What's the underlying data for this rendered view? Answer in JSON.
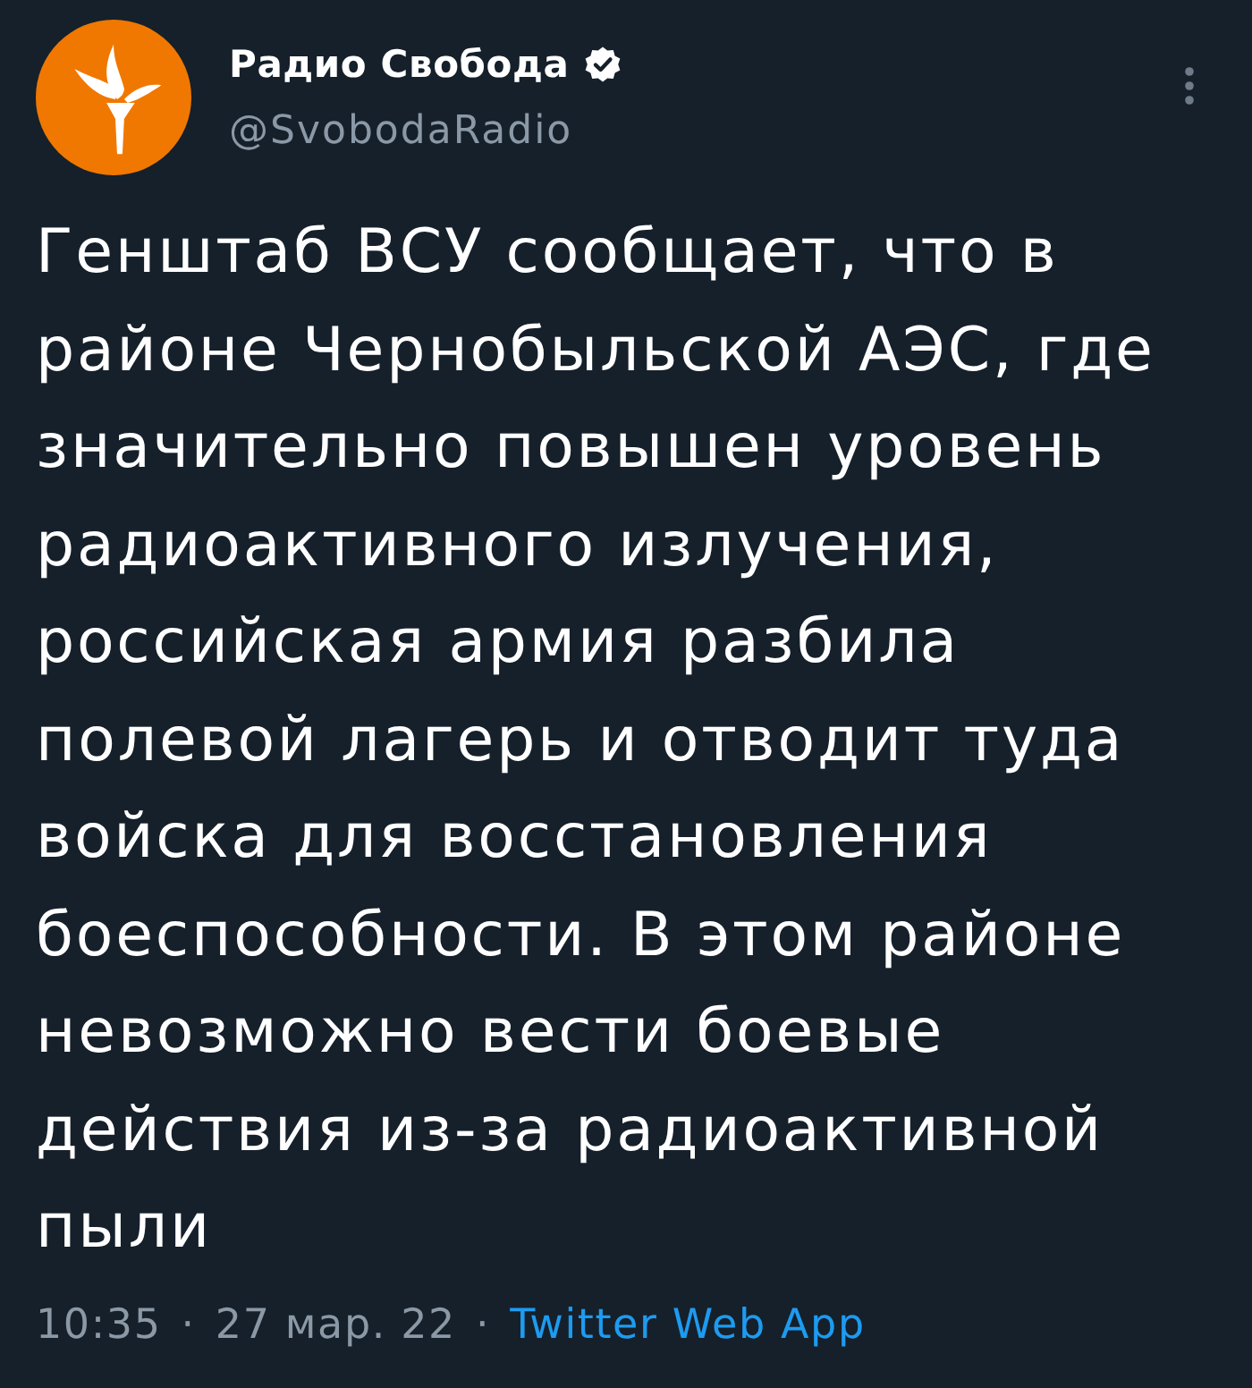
{
  "account": {
    "name": "Радио Свобода",
    "verified": true,
    "handle": "@SvobodaRadio"
  },
  "tweet": {
    "text": "Генштаб ВСУ сообщает, что в районе Чернобыльской АЭС, где значительно повышен уровень радиоактивного излучения, российская армия разбила полевой лагерь и отводит туда войска для восстановления боеспособности. В этом районе невозможно вести боевые действия из-за радиоактивной пыли"
  },
  "meta": [
    {
      "kind": "time",
      "text": "10:35"
    },
    {
      "kind": "dot",
      "text": "·"
    },
    {
      "kind": "date",
      "text": "27 мар. 22"
    },
    {
      "kind": "dot",
      "text": "·"
    },
    {
      "kind": "link",
      "text": "Twitter Web App"
    }
  ]
}
